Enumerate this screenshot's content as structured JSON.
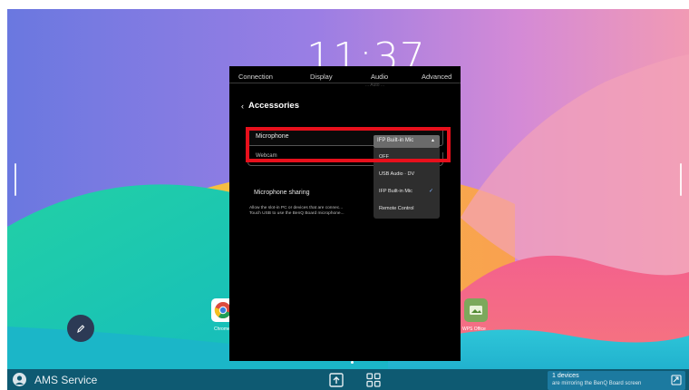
{
  "clock": {
    "time": "11:37"
  },
  "settings": {
    "tabs": [
      "Connection",
      "Display",
      "Audio",
      "Advanced"
    ],
    "ghost_text": "... Auto ...",
    "section_title": "Accessories",
    "microphone_label": "Microphone",
    "second_row_label": "Webcam",
    "sharing_label": "Microphone sharing",
    "sharing_desc_line1": "Allow the slot-in PC or devices that are connec...",
    "sharing_desc_line2": "Touch USB to use the BenQ Board microphone..."
  },
  "dropdown": {
    "selected": "IFP Built-in Mic",
    "options": [
      {
        "label": "OFF",
        "checked": false
      },
      {
        "label": "USB Audio · DV",
        "checked": false
      },
      {
        "label": "IFP Built-in Mic",
        "checked": true
      },
      {
        "label": "Remote Control",
        "checked": false
      }
    ]
  },
  "apps": [
    {
      "name": "Chrome",
      "icon": "chrome-icon"
    },
    {
      "name": "WPS Office",
      "icon": "folder-image-icon"
    }
  ],
  "taskbar": {
    "user_label": "AMS Service",
    "notification_title": "1 devices",
    "notification_text": "are mirroring the BenQ Board screen"
  },
  "colors": {
    "highlight": "#e8101c",
    "taskbar": "#0e5a72",
    "panel": "#000000"
  }
}
